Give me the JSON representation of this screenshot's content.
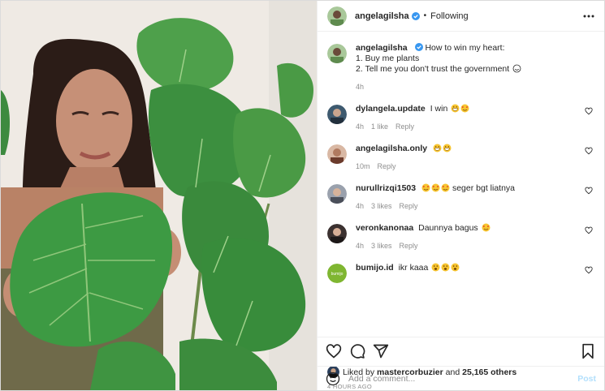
{
  "post": {
    "author": "angelagilsha",
    "follow_status": "Following",
    "separator": "•",
    "caption": {
      "user": "angelagilsha",
      "lines": [
        "How to win my heart:",
        "1. Buy me plants",
        "2. Tell me you don't trust the government"
      ],
      "time": "4h"
    }
  },
  "comments": [
    {
      "user": "dylangela.update",
      "text": "I win",
      "emojis": [
        "grin",
        "heart-eyes"
      ],
      "time": "4h",
      "likes": "1 like",
      "reply": "Reply"
    },
    {
      "user": "angelagilsha.only",
      "text": "",
      "emojis": [
        "grin",
        "grin"
      ],
      "time": "10m",
      "likes": "",
      "reply": "Reply"
    },
    {
      "user": "nurullrizqi1503",
      "text": "seger bgt liatnya",
      "emojis": [
        "heart-eyes",
        "heart-eyes",
        "heart-eyes"
      ],
      "time": "4h",
      "likes": "3 likes",
      "reply": "Reply"
    },
    {
      "user": "veronkanonaa",
      "text": "Daunnya bagus",
      "emojis": [
        "heart-eyes"
      ],
      "time": "4h",
      "likes": "3 likes",
      "reply": "Reply"
    },
    {
      "user": "bumijo.id",
      "text": "ikr kaaa",
      "emojis": [
        "anguished",
        "anguished",
        "anguished"
      ],
      "time": "",
      "likes": "",
      "reply": ""
    }
  ],
  "likes": {
    "prefix": "Liked by",
    "user": "mastercorbuzier",
    "conj": "and",
    "count": "25,165 others"
  },
  "timestamp": "4 HOURS AGO",
  "add_comment": {
    "placeholder": "Add a comment...",
    "post_label": "Post"
  },
  "icons": {
    "more": "more-icon",
    "verified": "verified-badge-icon",
    "like": "heart-icon",
    "comment": "comment-icon",
    "share": "paper-plane-icon",
    "save": "bookmark-icon",
    "emoji": "smiley-icon"
  },
  "colors": {
    "verified": "#3897f0",
    "post_disabled": "#b2dffc",
    "meta": "#8e8e8e"
  }
}
